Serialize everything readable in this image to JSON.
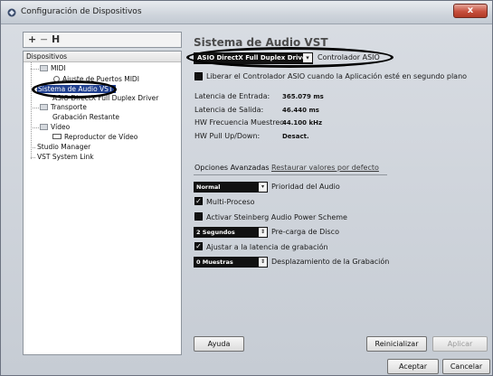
{
  "window": {
    "title": "Configuración de Dispositivos",
    "close_label": "x"
  },
  "left": {
    "toolbar": {
      "add": "+",
      "remove": "−",
      "reset": "H"
    },
    "tree_header": "Dispositivos",
    "items": {
      "midi": "MIDI",
      "midi_child": "Ajuste de Puertos MIDI",
      "audio": "Sistema de Audio VST",
      "audio_child": "ASIO DirectX Full Duplex Driver",
      "transport": "Transporte",
      "transport_child": "Grabación Restante",
      "video": "Vídeo",
      "video_child": "Reproductor de Vídeo",
      "studio": "Studio Manager",
      "vst_link": "VST System Link"
    }
  },
  "right": {
    "title": "Sistema de Audio VST",
    "driver": "ASIO DirectX Full Duplex Driver",
    "driver_label": "Controlador ASIO",
    "release_label": "Liberar el Controlador ASIO cuando la Aplicación esté en segundo plano",
    "input_latency_label": "Latencia de Entrada:",
    "input_latency": "365.079 ms",
    "output_latency_label": "Latencia de Salida:",
    "output_latency": "46.440 ms",
    "hw_freq_label": "HW Frecuencia Muestreo:",
    "hw_freq": "44.100 kHz",
    "hw_pull_label": "HW Pull Up/Down:",
    "hw_pull": "Desact.",
    "adv_options": "Opciones Avanzadas",
    "restore_defaults": "Restaurar valores por defecto",
    "priority_value": "Normal",
    "priority_label": "Prioridad del Audio",
    "multiprocess_label": "Multi-Proceso",
    "steinberg_label": "Activar Steinberg Audio Power Scheme",
    "disk_value": "2 Segundos",
    "disk_label": "Pre-carga de Disco",
    "adjust_label": "Ajustar a la latencia de grabación",
    "offset_value": "0 Muestras",
    "offset_label": "Desplazamiento de la Grabación"
  },
  "buttons": {
    "help": "Ayuda",
    "reset": "Reinicializar",
    "apply": "Aplicar",
    "ok": "Aceptar",
    "cancel": "Cancelar"
  }
}
